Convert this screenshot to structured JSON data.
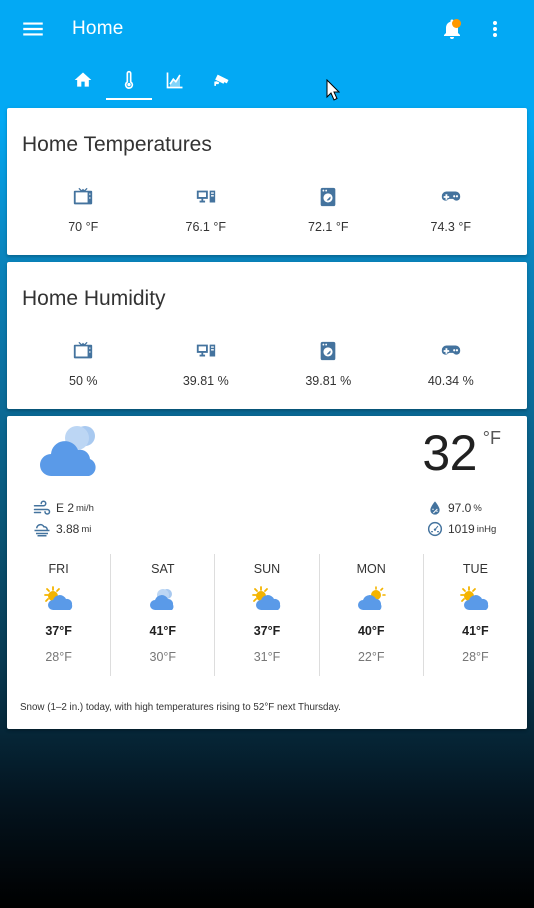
{
  "header": {
    "title": "Home",
    "icons": [
      "menu-icon",
      "bell-icon",
      "more-vert-icon"
    ],
    "notification_color": "#ff9800"
  },
  "tabs": [
    {
      "icon": "home-icon",
      "active": false
    },
    {
      "icon": "thermometer-icon",
      "active": true
    },
    {
      "icon": "chart-area-icon",
      "active": false
    },
    {
      "icon": "cctv-icon",
      "active": false
    }
  ],
  "colors": {
    "accent": "#03a9f4",
    "icon": "#44739e",
    "weather_blue": "#5a9ae8",
    "sun": "#f4b400"
  },
  "temperatures": {
    "title": "Home Temperatures",
    "items": [
      {
        "icon": "television-icon",
        "state": "70 °F"
      },
      {
        "icon": "desktop-tower-icon",
        "state": "76.1 °F"
      },
      {
        "icon": "washing-machine-icon",
        "state": "72.1 °F"
      },
      {
        "icon": "gamepad-icon",
        "state": "74.3 °F"
      }
    ]
  },
  "humidity": {
    "title": "Home Humidity",
    "items": [
      {
        "icon": "television-icon",
        "state": "50 %"
      },
      {
        "icon": "desktop-tower-icon",
        "state": "39.81 %"
      },
      {
        "icon": "washing-machine-icon",
        "state": "39.81 %"
      },
      {
        "icon": "gamepad-icon",
        "state": "40.34 %"
      }
    ]
  },
  "weather": {
    "condition_icon": "cloudy-icon",
    "temperature": "32",
    "unit": "°F",
    "wind": {
      "value": "E 2",
      "unit": "mi/h"
    },
    "visibility": {
      "value": "3.88",
      "unit": "mi"
    },
    "humidity": {
      "value": "97.0",
      "unit": "%"
    },
    "pressure": {
      "value": "1019",
      "unit": "inHg"
    },
    "forecast": [
      {
        "day": "FRI",
        "icon": "partly-cloudy-day-icon",
        "high": "37°F",
        "low": "28°F"
      },
      {
        "day": "SAT",
        "icon": "cloudy-icon",
        "high": "41°F",
        "low": "30°F"
      },
      {
        "day": "SUN",
        "icon": "partly-cloudy-day-icon",
        "high": "37°F",
        "low": "31°F"
      },
      {
        "day": "MON",
        "icon": "mostly-cloudy-day-icon",
        "high": "40°F",
        "low": "22°F"
      },
      {
        "day": "TUE",
        "icon": "partly-cloudy-day-icon",
        "high": "41°F",
        "low": "28°F"
      }
    ],
    "summary": "Snow (1–2 in.) today, with high temperatures rising to 52°F next Thursday."
  }
}
